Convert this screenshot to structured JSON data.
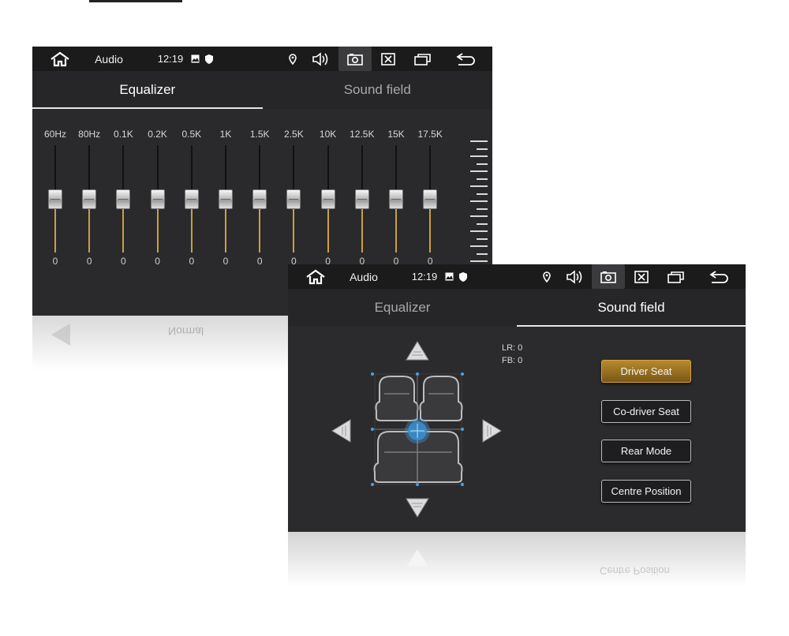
{
  "status_bar": {
    "app_title": "Audio",
    "time": "12:19",
    "icons": [
      "home-icon",
      "image-icon",
      "shield-icon",
      "location-icon",
      "volume-icon",
      "screenshot-icon",
      "close-box-icon",
      "recent-apps-icon",
      "back-icon"
    ]
  },
  "tabs": [
    {
      "label": "Equalizer"
    },
    {
      "label": "Sound field"
    }
  ],
  "equalizer": {
    "bands": [
      {
        "label": "60Hz",
        "value": "0",
        "level": 0.5
      },
      {
        "label": "80Hz",
        "value": "0",
        "level": 0.5
      },
      {
        "label": "0.1K",
        "value": "0",
        "level": 0.5
      },
      {
        "label": "0.2K",
        "value": "0",
        "level": 0.5
      },
      {
        "label": "0.5K",
        "value": "0",
        "level": 0.5
      },
      {
        "label": "1K",
        "value": "0",
        "level": 0.5
      },
      {
        "label": "1.5K",
        "value": "0",
        "level": 0.5
      },
      {
        "label": "2.5K",
        "value": "0",
        "level": 0.5
      },
      {
        "label": "10K",
        "value": "0",
        "level": 0.5
      },
      {
        "label": "12.5K",
        "value": "0",
        "level": 0.5
      },
      {
        "label": "15K",
        "value": "0",
        "level": 0.5
      },
      {
        "label": "17.5K",
        "value": "0",
        "level": 0.5
      }
    ],
    "preset": "Normal"
  },
  "sound_field": {
    "lr_label": "LR: 0",
    "fb_label": "FB: 0",
    "buttons": [
      {
        "label": "Driver Seat",
        "active": true
      },
      {
        "label": "Co-driver Seat",
        "active": false
      },
      {
        "label": "Rear Mode",
        "active": false
      },
      {
        "label": "Centre Position",
        "active": false
      }
    ]
  },
  "colors": {
    "accent": "#c9a040",
    "highlight_blue": "#4aa3e0",
    "screen_bg": "#2a2a2c"
  }
}
